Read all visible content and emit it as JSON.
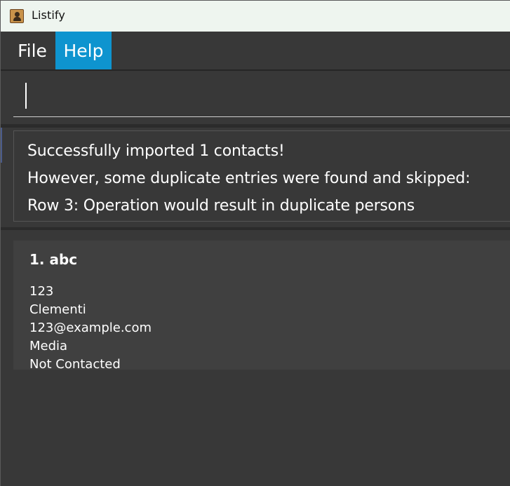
{
  "window": {
    "title": "Listify",
    "icon": "contact-book-icon"
  },
  "menu": {
    "items": [
      {
        "label": "File",
        "active": false
      },
      {
        "label": "Help",
        "active": true
      }
    ],
    "active_color": "#0e94cf"
  },
  "command_box": {
    "value": "",
    "placeholder": ""
  },
  "result_display": {
    "lines": [
      "Successfully imported 1 contacts!",
      "However, some duplicate entries were found and skipped:",
      "Row 3: Operation would result in duplicate persons"
    ]
  },
  "person_list": {
    "items": [
      {
        "title": "1. abc",
        "phone": "123",
        "address": "Clementi",
        "email": "123@example.com",
        "category": "Media",
        "status": "Not Contacted"
      }
    ]
  },
  "colors": {
    "background": "#383838",
    "card": "#404040",
    "titlebar": "#eef5ef",
    "text": "#ffffff"
  }
}
